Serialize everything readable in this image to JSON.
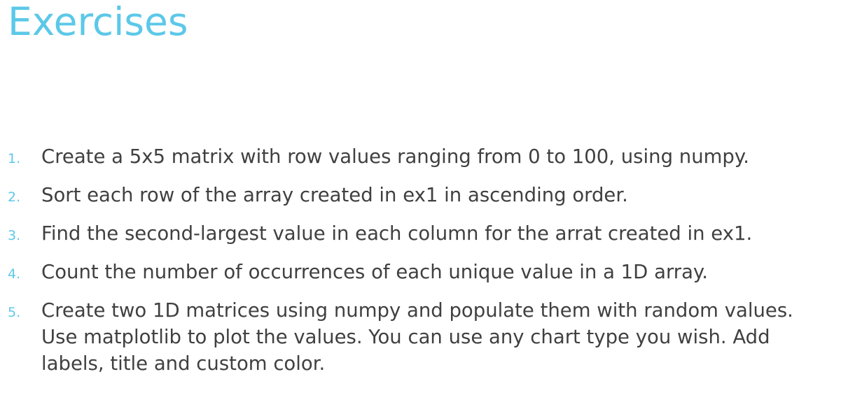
{
  "slide": {
    "title": "Exercises",
    "accent_color": "#5cc8e8",
    "text_color": "#404040"
  },
  "exercises": [
    {
      "number": "1.",
      "text": "Create a 5x5 matrix with row values ranging from 0 to 100, using numpy."
    },
    {
      "number": "2.",
      "text": "Sort each row of the array created in ex1 in ascending order."
    },
    {
      "number": "3.",
      "text": "Find the second-largest value in each column for the arrat created in ex1."
    },
    {
      "number": "4.",
      "text": "Count the number of occurrences of each unique value in a 1D array."
    },
    {
      "number": "5.",
      "text": "Create two 1D matrices using numpy and populate them with random values. Use matplotlib to plot the values. You can use any chart type you wish. Add labels, title and custom color."
    }
  ]
}
